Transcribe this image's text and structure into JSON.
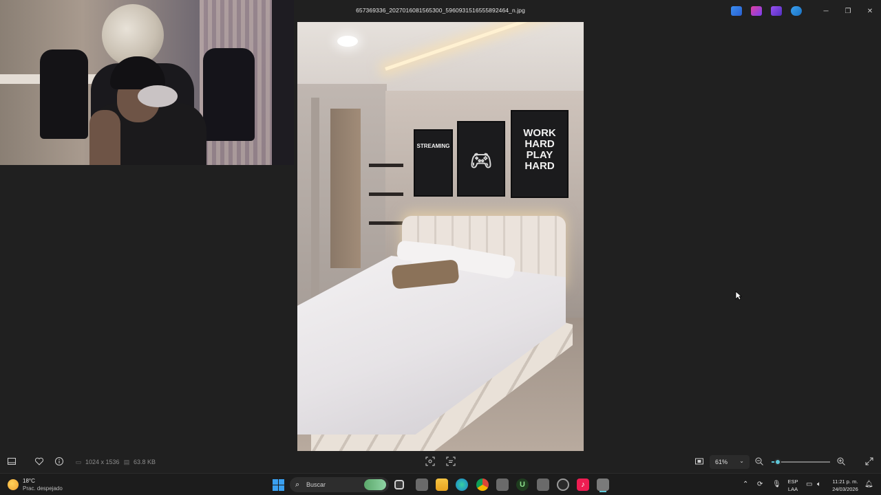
{
  "window": {
    "title": "657369336_2027016081565300_5960931516555892464_n.jpg",
    "minimize_glyph": "─",
    "maximize_glyph": "❐",
    "close_glyph": "✕"
  },
  "image": {
    "posters": [
      "STREAMING",
      "",
      "WORK\nHARD\nPLAY\nHARD"
    ]
  },
  "toolbar": {
    "dimensions": "1024 x 1536",
    "file_size": "63.8 KB",
    "zoom": "61%",
    "zoom_level": 0.1
  },
  "taskbar": {
    "weather_temp": "18°C",
    "weather_desc": "Prac. despejado",
    "search_placeholder": "Buscar",
    "lang_top": "ESP",
    "lang_bottom": "LAA",
    "time": "11:21 p. m.",
    "date": "24/03/2026"
  },
  "colors": {
    "accent": "#5fc7d8",
    "background": "#202020",
    "taskbar": "#1c1c1c"
  }
}
